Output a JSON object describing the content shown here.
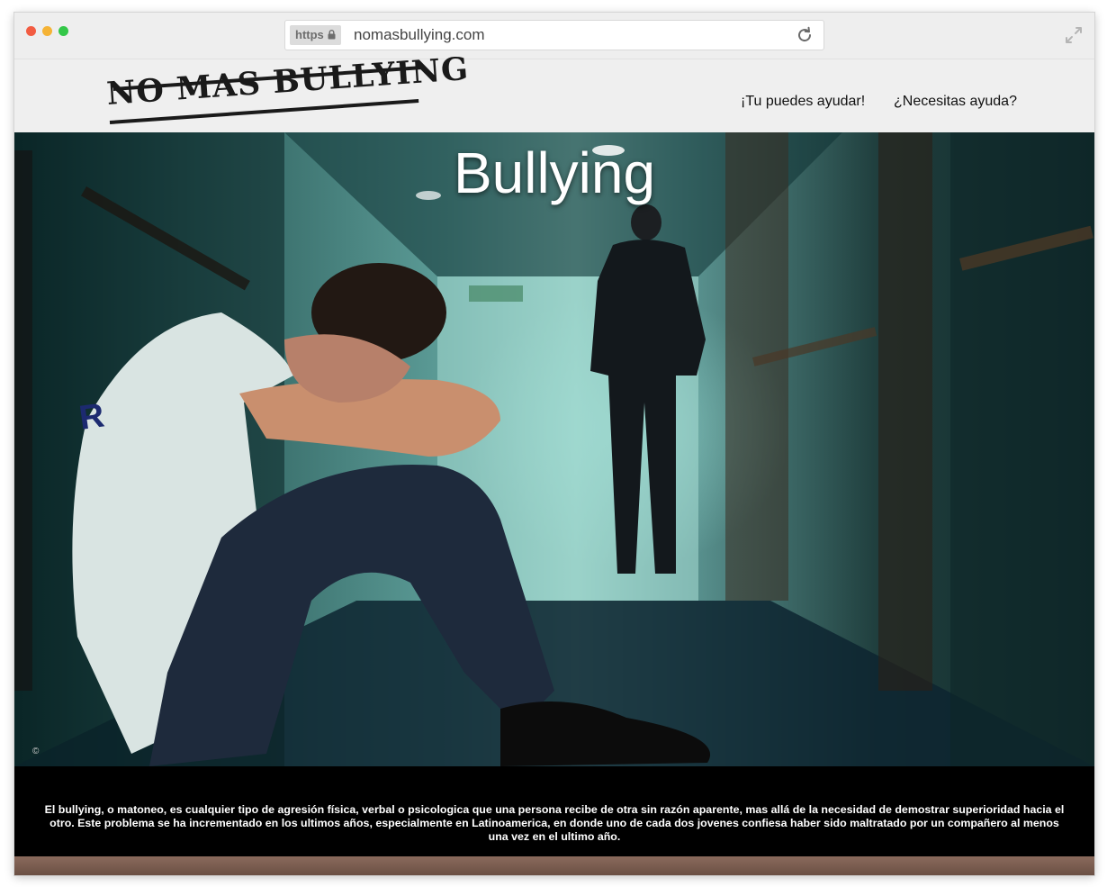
{
  "browser": {
    "https_label": "https",
    "url": "nomasbullying.com"
  },
  "site": {
    "logo_text": "NO MAS BULLYING",
    "nav": [
      {
        "label": "¡Tu puedes ayudar!"
      },
      {
        "label": "¿Necesitas ayuda?"
      }
    ]
  },
  "hero": {
    "title": "Bullying",
    "copyright": "©"
  },
  "caption": {
    "text": "El bullying, o matoneo, es cualquier tipo de agresión física, verbal o psicologica que una persona recibe de otra sin razón aparente, mas allá de la necesidad de demostrar superioridad hacia el otro. Este problema se ha incrementado en los ultimos años, especialmente en Latinoamerica, en donde uno de cada dos jovenes confiesa haber sido maltratado por un compañero al menos una vez en el ultimo año."
  },
  "colors": {
    "header_bg": "#efefef",
    "caption_bg": "#000000",
    "hero_tone": "#5c9c97"
  },
  "icons": [
    "lock-icon",
    "reload-icon",
    "expand-icon"
  ]
}
